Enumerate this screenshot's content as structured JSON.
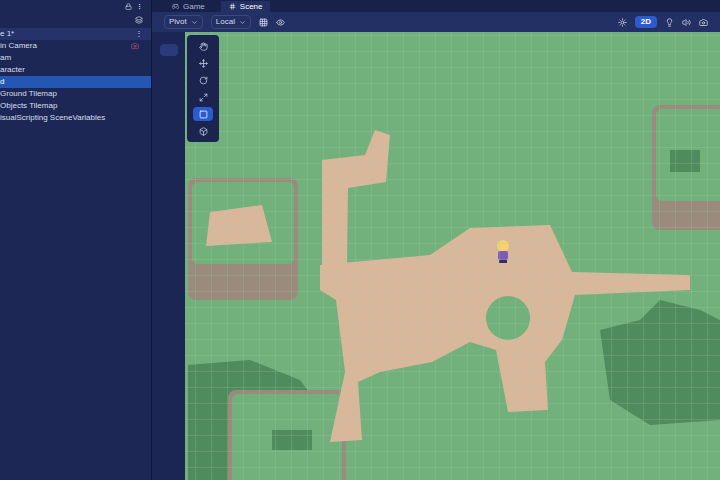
{
  "hierarchy": {
    "scene": {
      "label": "e 1*",
      "menu": "⋮"
    },
    "items": [
      {
        "label": "in Camera",
        "selected": false
      },
      {
        "label": "am",
        "selected": false
      },
      {
        "label": "aracter",
        "selected": false
      },
      {
        "label": "d",
        "selected": true
      },
      {
        "label": "Ground Tilemap",
        "selected": false
      },
      {
        "label": "Objects Tilemap",
        "selected": false
      },
      {
        "label": "isualScripting SceneVariables",
        "selected": false
      }
    ]
  },
  "tabs": [
    {
      "label": "Game",
      "selected": false
    },
    {
      "label": "Scene",
      "selected": true
    }
  ],
  "toolbar": {
    "pivot": "Pivot",
    "space": "Local",
    "mode": {
      "label": "2D",
      "selected": true
    }
  },
  "tools": [
    {
      "kind": "view",
      "selected": false
    },
    {
      "kind": "move",
      "selected": false
    },
    {
      "kind": "rotate",
      "selected": false
    },
    {
      "kind": "scale",
      "selected": false
    },
    {
      "kind": "rect",
      "selected": true
    },
    {
      "kind": "transform",
      "selected": false
    }
  ]
}
